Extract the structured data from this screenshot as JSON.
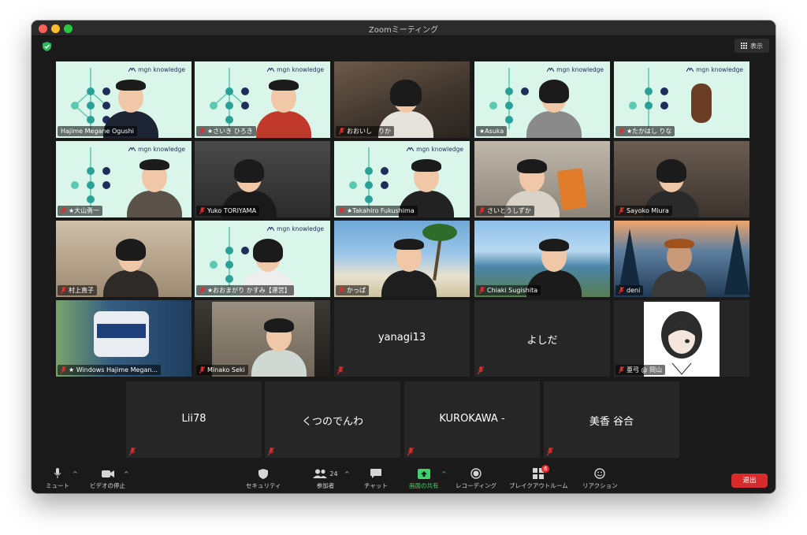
{
  "window": {
    "title": "Zoomミーティング"
  },
  "header": {
    "view_label": "表示"
  },
  "brand": {
    "logo_text": "mgn knowledge",
    "mint": "#daf6ea",
    "navy": "#1f2d5a",
    "teal": "#2aa198"
  },
  "tiles": [
    {
      "name": "Hajime Megane Ogushi",
      "muted": false
    },
    {
      "name": "★さいき ひろき",
      "muted": true,
      "active": true
    },
    {
      "name": "おおいし　りか",
      "muted": true
    },
    {
      "name": "★Asuka",
      "muted": false
    },
    {
      "name": "★たかはし りな",
      "muted": true
    },
    {
      "name": "★大山勇一",
      "muted": true
    },
    {
      "name": "Yuko TORIYAMA",
      "muted": true
    },
    {
      "name": "★Takahiro Fukushima",
      "muted": true
    },
    {
      "name": "さいとうしずか",
      "muted": true
    },
    {
      "name": "Sayoko Miura",
      "muted": true
    },
    {
      "name": "村上直子",
      "muted": true
    },
    {
      "name": "★おおまがり かすみ【運営】",
      "muted": true
    },
    {
      "name": "かっぱ",
      "muted": true
    },
    {
      "name": "Chiaki Sugishita",
      "muted": true
    },
    {
      "name": "deni",
      "muted": true
    },
    {
      "name": "★ Windows Hajime Megan...",
      "muted": true
    },
    {
      "name": "Minako Seki",
      "muted": true
    },
    {
      "name": "yanagi13",
      "muted": true
    },
    {
      "name": "よしだ",
      "muted": true
    },
    {
      "name": "亜弓 @ 岡山",
      "muted": true
    },
    {
      "name": "Lii78",
      "muted": true
    },
    {
      "name": "くつのでんわ",
      "muted": true
    },
    {
      "name": "KUROKAWA -",
      "muted": true
    },
    {
      "name": "美香 谷合",
      "muted": true
    }
  ],
  "toolbar": {
    "mute_label": "ミュート",
    "video_label": "ビデオの停止",
    "security_label": "セキュリティ",
    "participants_label": "参加者",
    "participants_count": "24",
    "chat_label": "チャット",
    "share_label": "画面の共有",
    "record_label": "レコーディング",
    "breakout_label": "ブレイクアウトルーム",
    "breakout_badge": "6",
    "reaction_label": "リアクション",
    "leave_label": "退出"
  },
  "colors": {
    "share_green": "#3ed36a",
    "leave_red": "#d92b2b",
    "active_outline": "#e9e78a",
    "mute_red": "#e02d2d"
  }
}
